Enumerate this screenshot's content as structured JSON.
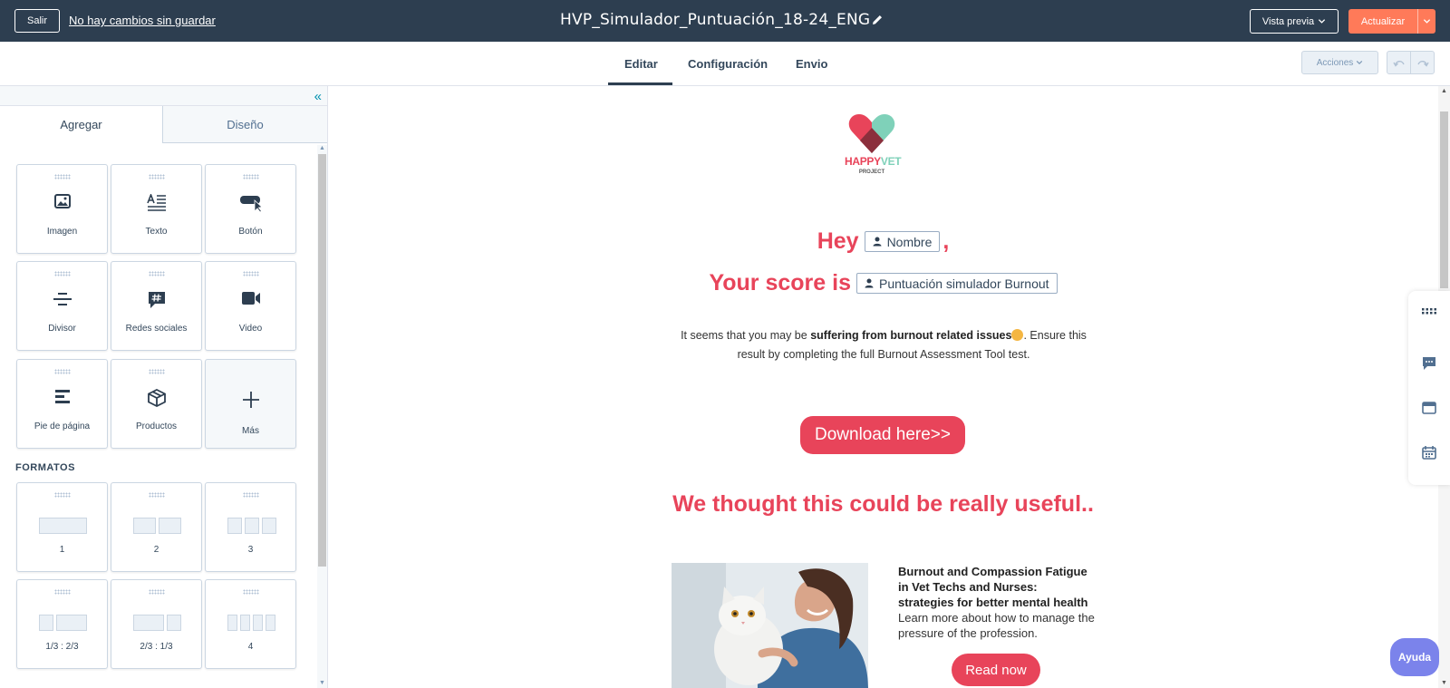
{
  "topbar": {
    "exit_label": "Salir",
    "unsaved_label": "No hay cambios sin guardar",
    "doc_title": "HVP_Simulador_Puntuación_18-24_ENG",
    "preview_label": "Vista previa",
    "update_label": "Actualizar"
  },
  "tabs": [
    {
      "label": "Editar",
      "active": true
    },
    {
      "label": "Configuración",
      "active": false
    },
    {
      "label": "Envio",
      "active": false
    }
  ],
  "toolbar": {
    "actions_label": "Acciones"
  },
  "sidebar": {
    "tab_add": "Agregar",
    "tab_design": "Diseño",
    "modules": [
      {
        "label": "Imagen",
        "icon": "image-icon"
      },
      {
        "label": "Texto",
        "icon": "text-icon"
      },
      {
        "label": "Botón",
        "icon": "button-icon"
      },
      {
        "label": "Divisor",
        "icon": "divider-icon"
      },
      {
        "label": "Redes sociales",
        "icon": "social-icon"
      },
      {
        "label": "Video",
        "icon": "video-icon"
      },
      {
        "label": "Pie de página",
        "icon": "footer-icon"
      },
      {
        "label": "Productos",
        "icon": "products-icon"
      },
      {
        "label": "Más",
        "icon": "plus-icon"
      }
    ],
    "formats_title": "FORMATOS",
    "formats": [
      {
        "label": "1"
      },
      {
        "label": "2"
      },
      {
        "label": "3"
      },
      {
        "label": "1/3 : 2/3"
      },
      {
        "label": "2/3 : 1/3"
      },
      {
        "label": "4"
      }
    ]
  },
  "email": {
    "logo_happy": "HAPPY",
    "logo_vet": "VET",
    "logo_project": "PROJECT",
    "greeting_word": "Hey",
    "name_token": "Nombre",
    "comma": ",",
    "score_prefix": "Your score is",
    "score_token": "Puntuación simulador Burnout",
    "para_part1": "It seems that you may be ",
    "para_bold": "suffering from burnout related issues",
    "para_part2": ". Ensure this result by completing the full Burnout Assessment Tool test.",
    "download_label": "Download here>>",
    "useful_heading": "We thought this could be really useful..",
    "article_title": "Burnout and Compassion Fatigue in Vet Techs and Nurses: strategies for better mental health",
    "article_desc": "Learn more about how to manage the pressure of the profession.",
    "read_label": "Read now"
  },
  "help_label": "Ayuda",
  "colors": {
    "topbar": "#2d3e50",
    "accent_orange": "#ff7a59",
    "brand_red": "#e8445a",
    "brand_mint": "#7fd1b9",
    "help_purple": "#7b83eb"
  }
}
